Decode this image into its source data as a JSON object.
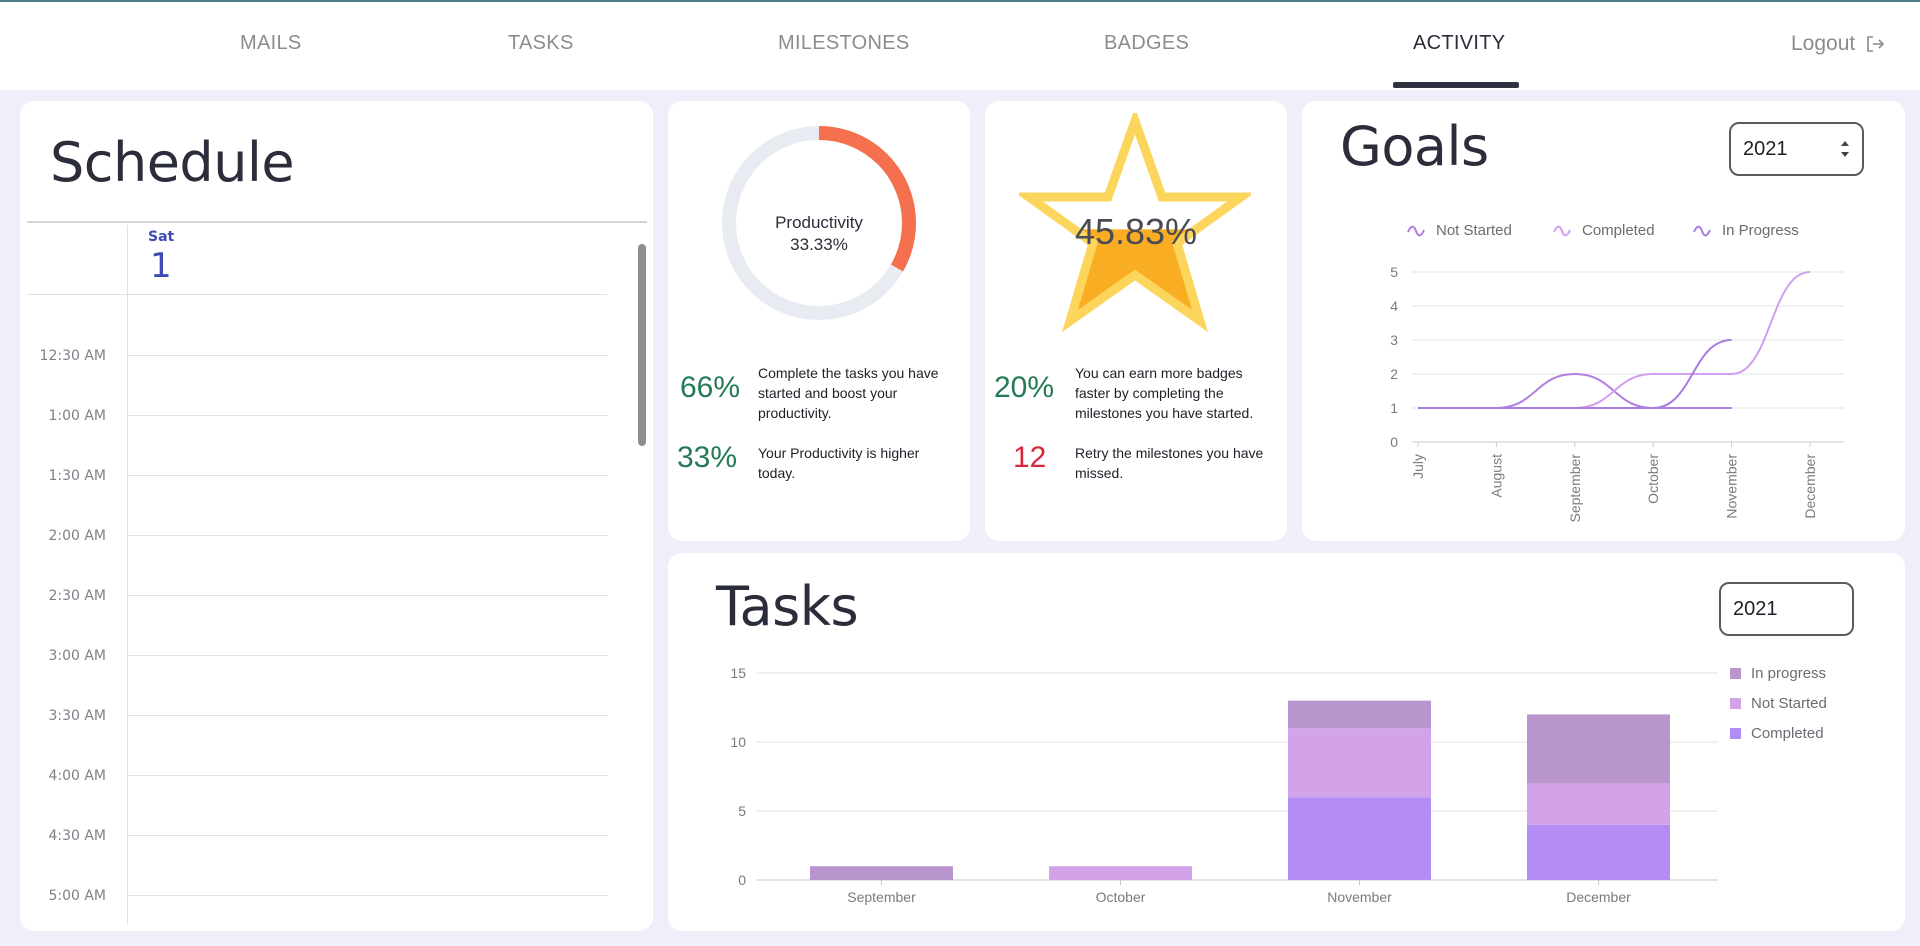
{
  "nav": {
    "items": [
      {
        "label": "MAILS",
        "active": false
      },
      {
        "label": "TASKS",
        "active": false
      },
      {
        "label": "MILESTONES",
        "active": false
      },
      {
        "label": "BADGES",
        "active": false
      },
      {
        "label": "ACTIVITY",
        "active": true
      }
    ],
    "logout_label": "Logout"
  },
  "schedule": {
    "title": "Schedule",
    "day": "Sat",
    "date": "1",
    "slots": [
      "12:30 AM",
      "1:00 AM",
      "1:30 AM",
      "2:00 AM",
      "2:30 AM",
      "3:00 AM",
      "3:30 AM",
      "4:00 AM",
      "4:30 AM",
      "5:00 AM"
    ]
  },
  "productivity": {
    "ring_label": "Productivity",
    "ring_value": "33.33%",
    "ring_fraction": 0.3333,
    "colors": {
      "ring": "#f4704f",
      "track": "#e8ecf2"
    },
    "stats": [
      {
        "value": "66%",
        "text": "Complete the tasks you have started and boost your productivity."
      },
      {
        "value": "33%",
        "text": "Your Productivity is higher today."
      }
    ]
  },
  "badges": {
    "star_value": "45.83%",
    "star_fraction": 0.4583,
    "colors": {
      "fill": "#f9ad23",
      "outline": "#fcd55c"
    },
    "stats": [
      {
        "value": "20%",
        "text": "You can earn more badges faster by completing the milestones you have started."
      },
      {
        "value": "12",
        "text": "Retry the milestones you have missed."
      }
    ]
  },
  "goals": {
    "title": "Goals",
    "year": "2021"
  },
  "tasks": {
    "title": "Tasks",
    "year": "2021"
  },
  "chart_data": [
    {
      "type": "line",
      "x": [
        "July",
        "August",
        "September",
        "October",
        "November",
        "December"
      ],
      "series": [
        {
          "name": "Not Started",
          "values": [
            1,
            1,
            2,
            1,
            1,
            null
          ],
          "color": "#b07fe0"
        },
        {
          "name": "Completed",
          "values": [
            1,
            1,
            1,
            2,
            2,
            5
          ],
          "color": "#d29ef0"
        },
        {
          "name": "In Progress",
          "values": [
            1,
            1,
            1,
            1,
            3,
            null
          ],
          "color": "#a87de0"
        }
      ],
      "ylim": [
        0,
        5
      ],
      "yticks": [
        0,
        1,
        2,
        3,
        4,
        5
      ],
      "legend": "top",
      "grid": true
    },
    {
      "type": "bar",
      "stacked": true,
      "categories": [
        "September",
        "October",
        "November",
        "December"
      ],
      "series": [
        {
          "name": "In progress",
          "values": [
            1,
            0,
            2,
            5
          ],
          "color": "#b995cd"
        },
        {
          "name": "Not Started",
          "values": [
            0,
            1,
            5,
            3
          ],
          "color": "#d3a3ea"
        },
        {
          "name": "Completed",
          "values": [
            0,
            0,
            6,
            4
          ],
          "color": "#b38df5"
        }
      ],
      "ylim": [
        0,
        15
      ],
      "yticks": [
        0,
        5,
        10,
        15
      ],
      "legend": "right",
      "grid": true
    }
  ]
}
